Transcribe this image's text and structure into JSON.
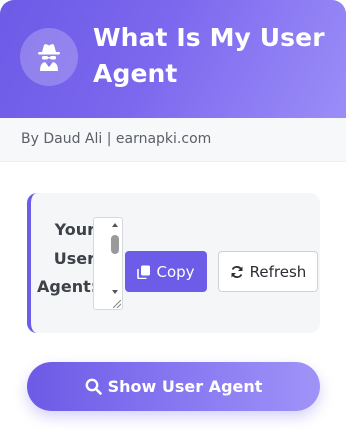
{
  "header": {
    "title": "What Is My User Agent",
    "logo_icon": "user-secret-icon"
  },
  "byline": "By Daud Ali | earnapki.com",
  "panel": {
    "label": "Your User Agent:",
    "textarea_value": "",
    "copy_label": "Copy",
    "copy_icon": "copy-icon",
    "refresh_label": "Refresh",
    "refresh_icon": "refresh-icon"
  },
  "show_button": {
    "label": "Show User Agent",
    "icon": "search-icon"
  },
  "colors": {
    "accent": "#6c5ce7",
    "gradient_end": "#a093f7",
    "panel_bg": "#f5f6f8",
    "byline_bg": "#f7f8fa"
  }
}
